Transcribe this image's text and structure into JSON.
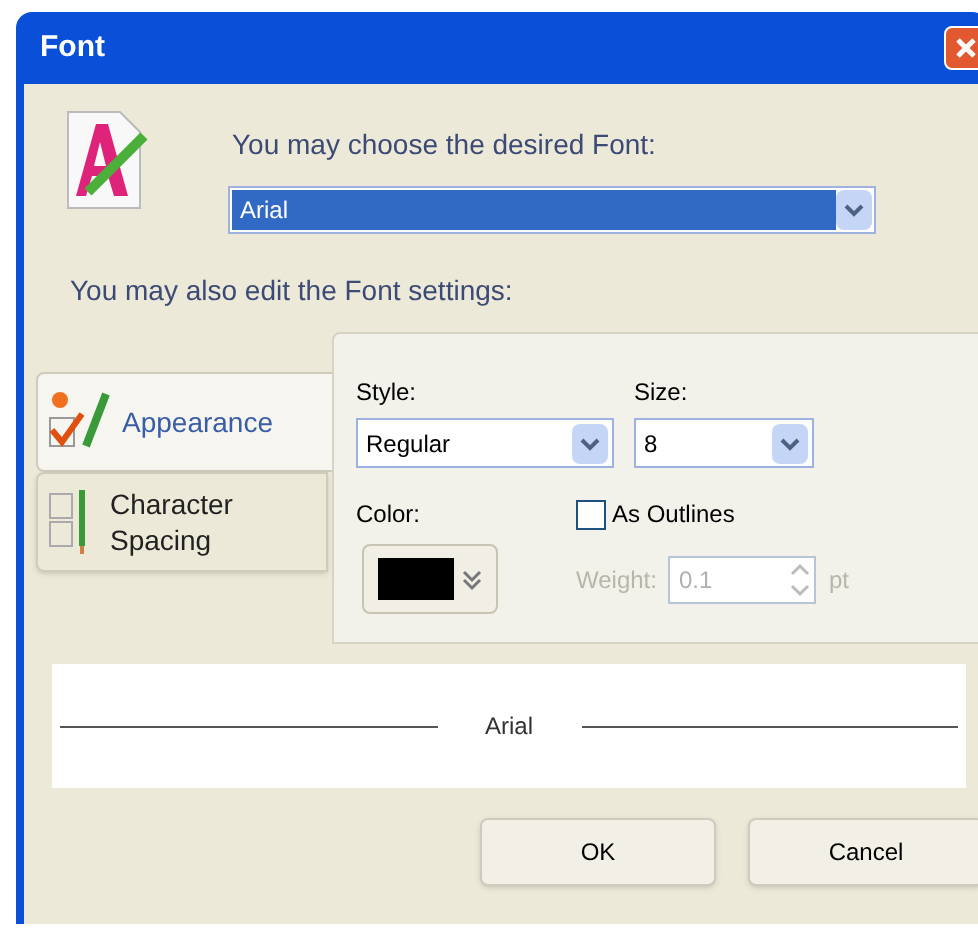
{
  "window": {
    "title": "Font"
  },
  "font_prompt": "You may choose the desired Font:",
  "font_select": {
    "value": "Arial",
    "selected": true
  },
  "settings_prompt": "You may also edit the Font settings:",
  "tabs": [
    {
      "label": "Appearance",
      "selected": true,
      "kind": "appearance"
    },
    {
      "label": "Character Spacing",
      "selected": false,
      "kind": "spacing"
    }
  ],
  "appearance": {
    "style": {
      "label": "Style:",
      "value": "Regular"
    },
    "size": {
      "label": "Size:",
      "value": "8"
    },
    "color": {
      "label": "Color:",
      "color": "#000000"
    },
    "as_outlines": {
      "label": "As Outlines",
      "checked": false
    },
    "weight": {
      "label": "Weight:",
      "value": "0.1",
      "unit": "pt",
      "disabled": true
    }
  },
  "preview": {
    "text": "Arial"
  },
  "buttons": [
    "OK",
    "Cancel"
  ]
}
